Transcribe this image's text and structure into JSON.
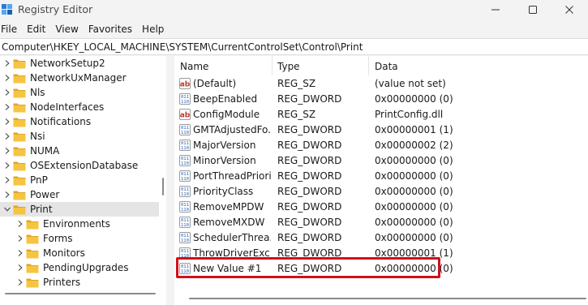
{
  "window": {
    "title": "Registry Editor"
  },
  "menu": [
    "File",
    "Edit",
    "View",
    "Favorites",
    "Help"
  ],
  "address": "Computer\\HKEY_LOCAL_MACHINE\\SYSTEM\\CurrentControlSet\\Control\\Print",
  "tree": [
    {
      "label": "NetworkSetup2",
      "level": 0,
      "expanded": false,
      "selected": false
    },
    {
      "label": "NetworkUxManager",
      "level": 0,
      "expanded": false,
      "selected": false
    },
    {
      "label": "Nls",
      "level": 0,
      "expanded": false,
      "selected": false
    },
    {
      "label": "NodeInterfaces",
      "level": 0,
      "expanded": false,
      "selected": false
    },
    {
      "label": "Notifications",
      "level": 0,
      "expanded": false,
      "selected": false
    },
    {
      "label": "Nsi",
      "level": 0,
      "expanded": false,
      "selected": false
    },
    {
      "label": "NUMA",
      "level": 0,
      "expanded": false,
      "selected": false
    },
    {
      "label": "OSExtensionDatabase",
      "level": 0,
      "expanded": false,
      "selected": false
    },
    {
      "label": "PnP",
      "level": 0,
      "expanded": false,
      "selected": false
    },
    {
      "label": "Power",
      "level": 0,
      "expanded": false,
      "selected": false
    },
    {
      "label": "Print",
      "level": 0,
      "expanded": true,
      "selected": true
    },
    {
      "label": "Environments",
      "level": 1,
      "expanded": false,
      "selected": false
    },
    {
      "label": "Forms",
      "level": 1,
      "expanded": false,
      "selected": false
    },
    {
      "label": "Monitors",
      "level": 1,
      "expanded": false,
      "selected": false
    },
    {
      "label": "PendingUpgrades",
      "level": 1,
      "expanded": false,
      "selected": false
    },
    {
      "label": "Printers",
      "level": 1,
      "expanded": false,
      "selected": false
    }
  ],
  "list": {
    "columns": {
      "name": "Name",
      "type": "Type",
      "data": "Data"
    },
    "rows": [
      {
        "icon": "string-value-icon",
        "name": "(Default)",
        "type": "REG_SZ",
        "data": "(value not set)"
      },
      {
        "icon": "binary-value-icon",
        "name": "BeepEnabled",
        "type": "REG_DWORD",
        "data": "0x00000000 (0)"
      },
      {
        "icon": "string-value-icon",
        "name": "ConfigModule",
        "type": "REG_SZ",
        "data": "PrintConfig.dll"
      },
      {
        "icon": "binary-value-icon",
        "name": "GMTAdjustedFo...",
        "type": "REG_DWORD",
        "data": "0x00000001 (1)"
      },
      {
        "icon": "binary-value-icon",
        "name": "MajorVersion",
        "type": "REG_DWORD",
        "data": "0x00000002 (2)"
      },
      {
        "icon": "binary-value-icon",
        "name": "MinorVersion",
        "type": "REG_DWORD",
        "data": "0x00000000 (0)"
      },
      {
        "icon": "binary-value-icon",
        "name": "PortThreadPriority",
        "type": "REG_DWORD",
        "data": "0x00000000 (0)"
      },
      {
        "icon": "binary-value-icon",
        "name": "PriorityClass",
        "type": "REG_DWORD",
        "data": "0x00000000 (0)"
      },
      {
        "icon": "binary-value-icon",
        "name": "RemoveMPDW",
        "type": "REG_DWORD",
        "data": "0x00000000 (0)"
      },
      {
        "icon": "binary-value-icon",
        "name": "RemoveMXDW",
        "type": "REG_DWORD",
        "data": "0x00000000 (0)"
      },
      {
        "icon": "binary-value-icon",
        "name": "SchedulerThrea...",
        "type": "REG_DWORD",
        "data": "0x00000000 (0)"
      },
      {
        "icon": "binary-value-icon",
        "name": "ThrowDriverExc...",
        "type": "REG_DWORD",
        "data": "0x00000001 (1)"
      },
      {
        "icon": "binary-value-icon",
        "name": "New Value #1",
        "type": "REG_DWORD",
        "data": "0x00000000 (0)"
      }
    ]
  },
  "colors": {
    "accent": "#d0101a",
    "folder": "#f5c542",
    "selection": "#e5e5e5"
  }
}
